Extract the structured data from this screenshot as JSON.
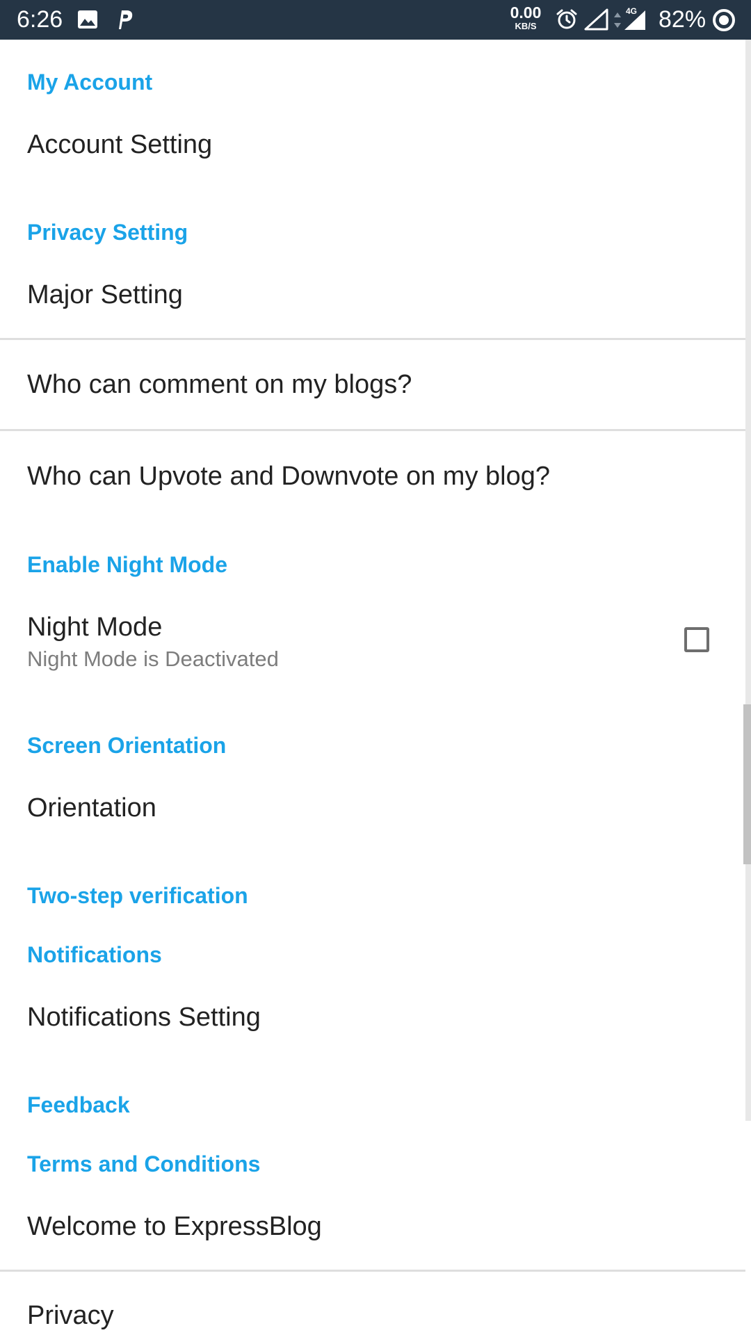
{
  "status_bar": {
    "time": "6:26",
    "net_speed_value": "0.00",
    "net_speed_unit": "KB/S",
    "network_type": "4G",
    "battery": "82%",
    "icons": [
      "image-icon",
      "p-app-icon",
      "alarm-icon",
      "signal-empty-icon",
      "data-arrows-icon",
      "signal-full-icon",
      "battery-ring-icon"
    ],
    "color": "#253545"
  },
  "accent_color": "#1aa3e8",
  "settings": {
    "my_account": {
      "header": "My Account",
      "account_setting": "Account Setting"
    },
    "privacy": {
      "header": "Privacy Setting",
      "major_setting": "Major Setting",
      "comment_setting": "Who can comment on my blogs?",
      "vote_setting": "Who can Upvote and Downvote on my blog?"
    },
    "night_mode": {
      "header": "Enable Night Mode",
      "title": "Night Mode",
      "summary": "Night Mode is Deactivated",
      "checked": false
    },
    "orientation": {
      "header": "Screen Orientation",
      "title": "Orientation"
    },
    "two_step": {
      "header": "Two-step verification"
    },
    "notifications": {
      "header": "Notifications",
      "title": "Notifications Setting"
    },
    "feedback": {
      "header": "Feedback"
    },
    "terms": {
      "header": "Terms and Conditions",
      "welcome": "Welcome to ExpressBlog",
      "privacy": "Privacy"
    }
  }
}
